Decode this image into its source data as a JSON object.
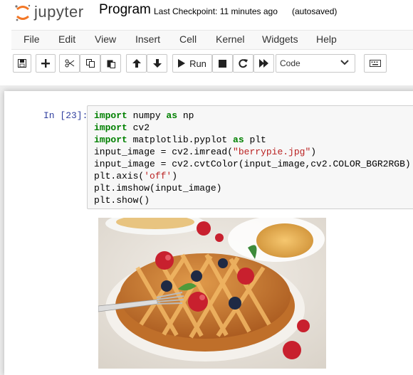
{
  "header": {
    "logo_text": "jupyter",
    "notebook_name": "Program",
    "checkpoint": "Last Checkpoint: 11 minutes ago",
    "autosave": "(autosaved)"
  },
  "menu": [
    "File",
    "Edit",
    "View",
    "Insert",
    "Cell",
    "Kernel",
    "Widgets",
    "Help"
  ],
  "toolbar": {
    "run_label": "Run",
    "cell_type": "Code",
    "icons": [
      "save-icon",
      "add-icon",
      "cut-icon",
      "copy-icon",
      "paste-icon",
      "move-up-icon",
      "move-down-icon",
      "run-icon",
      "stop-icon",
      "restart-icon",
      "fast-forward-icon",
      "chevron-down-icon",
      "keyboard-icon"
    ]
  },
  "cell": {
    "prompt": "In [23]:",
    "code": [
      {
        "parts": [
          {
            "t": "import",
            "k": "kw"
          },
          {
            "t": " numpy "
          },
          {
            "t": "as",
            "k": "kw"
          },
          {
            "t": " np"
          }
        ]
      },
      {
        "parts": [
          {
            "t": "import",
            "k": "kw"
          },
          {
            "t": " cv2"
          }
        ]
      },
      {
        "parts": [
          {
            "t": "import",
            "k": "kw"
          },
          {
            "t": " matplotlib.pyplot "
          },
          {
            "t": "as",
            "k": "kw"
          },
          {
            "t": " plt"
          }
        ]
      },
      {
        "parts": [
          {
            "t": "input_image = cv2.imread("
          },
          {
            "t": "\"berrypie.jpg\"",
            "k": "str"
          },
          {
            "t": ")"
          }
        ]
      },
      {
        "parts": [
          {
            "t": "input_image = cv2.cvtColor(input_image,cv2.COLOR_BGR2RGB)"
          }
        ]
      },
      {
        "parts": [
          {
            "t": "plt.axis("
          },
          {
            "t": "'off'",
            "k": "str"
          },
          {
            "t": ")"
          }
        ]
      },
      {
        "parts": [
          {
            "t": "plt.imshow(input_image)"
          }
        ]
      },
      {
        "parts": [
          {
            "t": "plt.show()"
          }
        ]
      }
    ]
  },
  "output": {
    "image": "berry-pie-photo",
    "colors": {
      "crust": "#c9762c",
      "raspberry": "#c8202e",
      "blueberry": "#1f2a44",
      "plate": "#f4f1ec",
      "tea": "#e0a030"
    }
  },
  "colors": {
    "prompt": "#303f9f",
    "keyword": "#008000",
    "string": "#ba2121",
    "logo_orange": "#f37726"
  }
}
